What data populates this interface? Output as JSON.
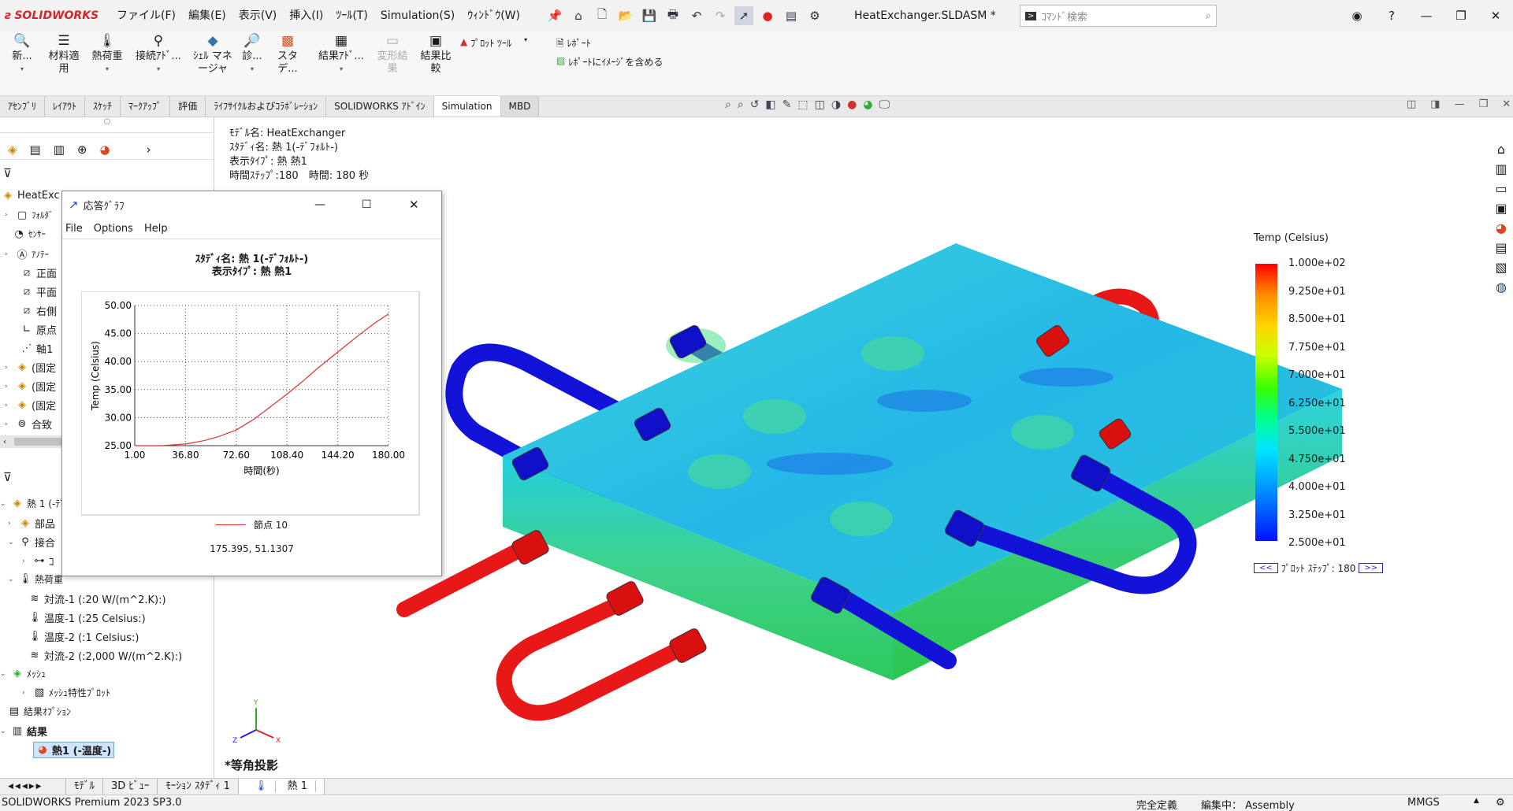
{
  "app": {
    "brand": "SOLIDWORKS",
    "doc_title": "HeatExchanger.SLDASM *",
    "search_placeholder": "ｺﾏﾝﾄﾞ検索"
  },
  "menu": [
    "ファイル(F)",
    "編集(E)",
    "表示(V)",
    "挿入(I)",
    "ﾂｰﾙ(T)",
    "Simulation(S)",
    "ｳｨﾝﾄﾞｳ(W)"
  ],
  "cmd": {
    "b1": "新...",
    "b2": "材料適用",
    "b3": "熱荷重",
    "b4": "接続ｱﾄﾞ...",
    "b5": "ｼｪﾙ マネージャ",
    "b6": "診...",
    "b7": "スタデ...",
    "b8": "結果ｱﾄﾞ...",
    "b9": "変形結果",
    "b10": "結果比較",
    "plot_tools": "ﾌﾟﾛｯﾄ ﾂｰﾙ",
    "report": "ﾚﾎﾟｰﾄ",
    "report_img": "ﾚﾎﾟｰﾄにｲﾒｰｼﾞを含める"
  },
  "tabs": [
    "ｱｾﾝﾌﾞﾘ",
    "ﾚｲｱｳﾄ",
    "ｽｹｯﾁ",
    "ﾏｰｸｱｯﾌﾟ",
    "評価",
    "ﾗｲﾌｻｲｸﾙおよびｺﾗﾎﾞﾚｰｼｮﾝ",
    "SOLIDWORKS ｱﾄﾞｲﾝ",
    "Simulation",
    "MBD"
  ],
  "tree": {
    "top": [
      "HeatExc",
      "ﾌｫﾙﾀﾞ",
      "ｾﾝｻｰ",
      "ｱﾉﾃｰ",
      "正面",
      "平面",
      "右側",
      "原点",
      "軸1",
      "(固定",
      "(固定",
      "(固定",
      "合致"
    ],
    "study": "熱 1 (-ﾃﾞ",
    "s1": "部品",
    "s2": "接合",
    "s3": "ｺ",
    "loads": "熱荷重",
    "l1": "対流-1 (:20 W/(m^2.K):)",
    "l2": "温度-1 (:25 Celsius:)",
    "l3": "温度-2 (:1 Celsius:)",
    "l4": "対流-2 (:2,000 W/(m^2.K):)",
    "mesh": "ﾒｯｼｭ",
    "mesh_plot": "ﾒｯｼｭ特性ﾌﾟﾛｯﾄ",
    "result_opt": "結果ｵﾌﾟｼｮﾝ",
    "results": "結果",
    "res1": "熱1 (-温度-)"
  },
  "info": {
    "l1": "ﾓﾃﾞﾙ名: HeatExchanger",
    "l2": "ｽﾀﾃﾞｨ名: 熱 1(-ﾃﾞﾌｫﾙﾄ-)",
    "l3": "表示ﾀｲﾌﾟ: 熱 熱1",
    "l4": "時間ｽﾃｯﾌﾟ:180　時間: 180 秒"
  },
  "legend": {
    "title": "Temp (Celsius)",
    "values": [
      "1.000e+02",
      "9.250e+01",
      "8.500e+01",
      "7.750e+01",
      "7.000e+01",
      "6.250e+01",
      "5.500e+01",
      "4.750e+01",
      "4.000e+01",
      "3.250e+01",
      "2.500e+01"
    ],
    "prev": "<<",
    "next": ">>",
    "step": "ﾌﾟﾛｯﾄ ｽﾃｯﾌﾟ: 180"
  },
  "view_label": "*等角投影",
  "dialog": {
    "title": "応答ｸﾞﾗﾌ",
    "menu": [
      "File",
      "Options",
      "Help"
    ],
    "readout": "175.395, 51.1307",
    "legend_entry": "節点 10"
  },
  "chart_data": {
    "type": "line",
    "title": "ｽﾀﾃﾞｨ名: 熱 1(-ﾃﾞﾌｫﾙﾄ-)",
    "subtitle": "表示ﾀｲﾌﾟ: 熱 熱1",
    "xlabel": "時間(秒)",
    "ylabel": "Temp (Celsius)",
    "xlim": [
      1,
      180
    ],
    "ylim": [
      25,
      50
    ],
    "xticks": [
      "1.00",
      "36.80",
      "72.60",
      "108.40",
      "144.20",
      "180.00"
    ],
    "yticks": [
      "25.00",
      "30.00",
      "35.00",
      "40.00",
      "45.00",
      "50.00"
    ],
    "series": [
      {
        "name": "節点 10",
        "color": "#e03030",
        "x": [
          1,
          20,
          36.8,
          50,
          60,
          72.6,
          85,
          95,
          108.4,
          120,
          130,
          144.2,
          160,
          170,
          180
        ],
        "y": [
          25,
          25,
          25.3,
          25.9,
          26.6,
          27.8,
          29.7,
          31.6,
          34.2,
          36.6,
          38.8,
          41.7,
          44.9,
          46.8,
          48.5
        ]
      }
    ]
  },
  "bottom_tabs": [
    "ﾓﾃﾞﾙ",
    "3D ﾋﾞｭｰ",
    "ﾓｰｼｮﾝ ｽﾀﾃﾞｨ 1",
    "熱 1"
  ],
  "status": {
    "left": "SOLIDWORKS Premium 2023 SP3.0",
    "s1": "完全定義",
    "s2": "編集中： Assembly",
    "s3": "MMGS"
  }
}
